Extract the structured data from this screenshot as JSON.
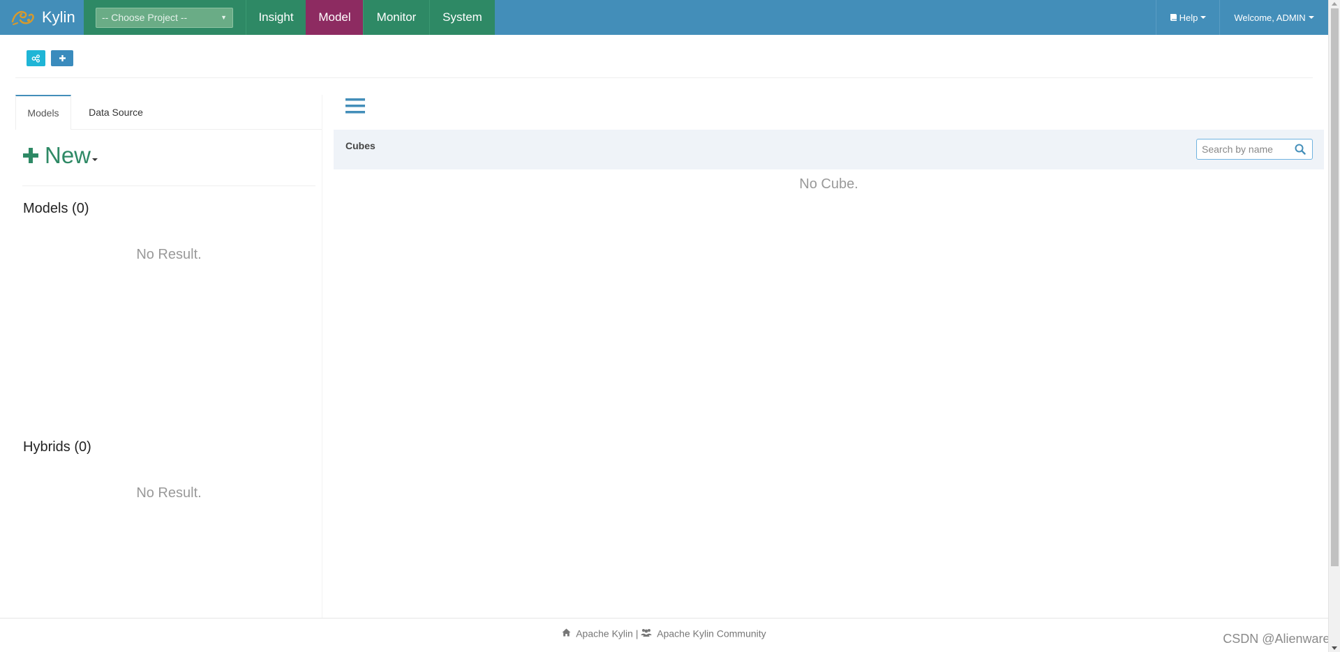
{
  "app": {
    "brand_name": "Kylin"
  },
  "navbar": {
    "project_select": {
      "value": "-- Choose Project --"
    },
    "tabs": [
      {
        "label": "Insight",
        "active": false
      },
      {
        "label": "Model",
        "active": true
      },
      {
        "label": "Monitor",
        "active": false
      },
      {
        "label": "System",
        "active": false
      }
    ],
    "help_label": "Help",
    "user_label": "Welcome, ADMIN"
  },
  "left_panel": {
    "tabs": [
      {
        "label": "Models",
        "active": true
      },
      {
        "label": "Data Source",
        "active": false
      }
    ],
    "new_label": "New",
    "models_title": "Models (0)",
    "models_empty": "No Result.",
    "hybrids_title": "Hybrids (0)",
    "hybrids_empty": "No Result."
  },
  "right_panel": {
    "cubes_title": "Cubes",
    "search_placeholder": "Search by name",
    "empty_message": "No Cube."
  },
  "footer": {
    "link1": "Apache Kylin",
    "separator": "|",
    "link2": "Apache Kylin Community"
  },
  "watermark": "CSDN @Alienware^",
  "icons": {
    "brand": "kylin-logo-icon",
    "help": "book-icon",
    "toolbar_1": "sitemap-icon",
    "toolbar_2": "plus-icon",
    "new": "plus-icon",
    "menu": "bars-icon",
    "search": "search-icon",
    "footer_1": "home-icon",
    "footer_2": "users-icon"
  },
  "colors": {
    "navbar_bg": "#438eb9",
    "nav_tab_bg": "#2e8965",
    "nav_tab_active": "#8d2b61",
    "new_text": "#2e8965",
    "cubes_bar_bg": "#eff3f8"
  }
}
